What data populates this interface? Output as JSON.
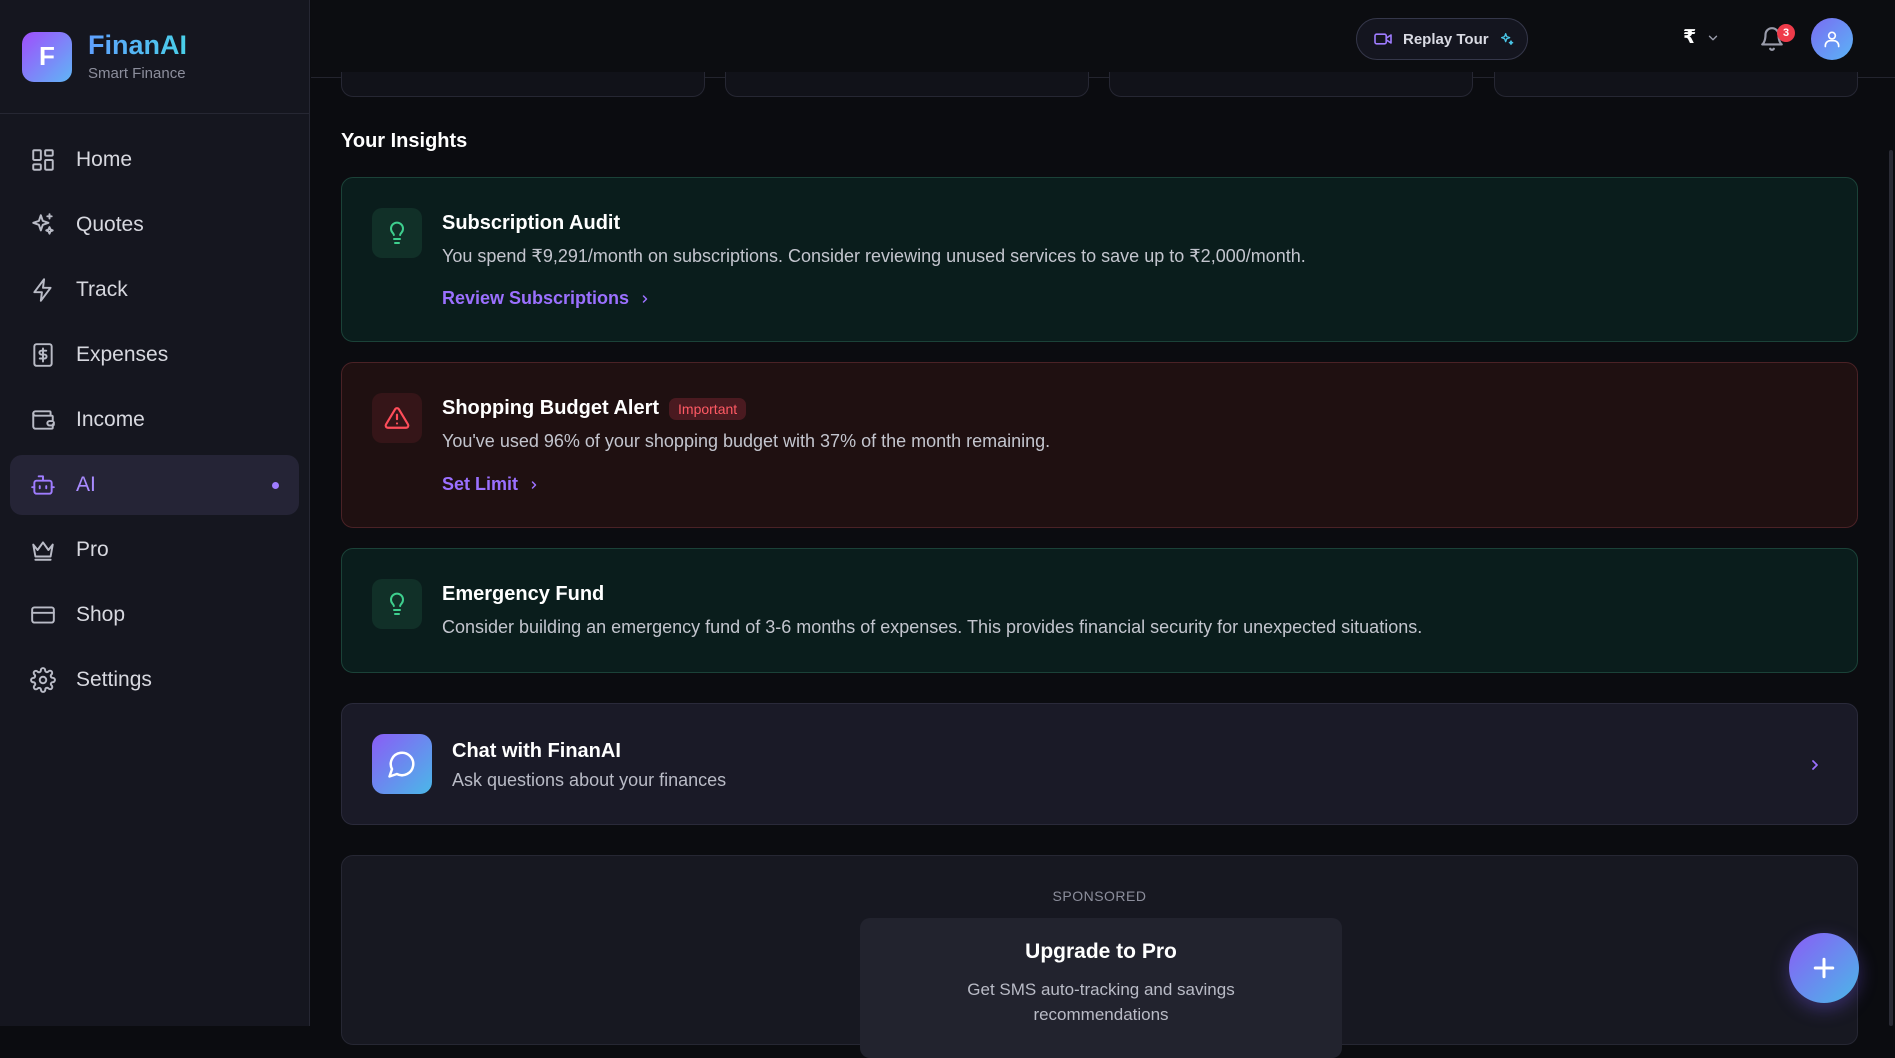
{
  "brand": {
    "logo_letter": "F",
    "name": "FinanAI",
    "subtitle": "Smart Finance"
  },
  "sidebar": {
    "items": [
      {
        "label": "Home",
        "icon": "grid-icon",
        "active": false
      },
      {
        "label": "Quotes",
        "icon": "sparkles-icon",
        "active": false
      },
      {
        "label": "Track",
        "icon": "lightning-icon",
        "active": false
      },
      {
        "label": "Expenses",
        "icon": "dollar-receipt-icon",
        "active": false
      },
      {
        "label": "Income",
        "icon": "wallet-icon",
        "active": false
      },
      {
        "label": "AI",
        "icon": "robot-icon",
        "active": true
      },
      {
        "label": "Pro",
        "icon": "crown-icon",
        "active": false
      },
      {
        "label": "Shop",
        "icon": "credit-card-icon",
        "active": false
      },
      {
        "label": "Settings",
        "icon": "gear-icon",
        "active": false
      }
    ]
  },
  "header": {
    "replay_tour_label": "Replay Tour",
    "currency_symbol": "₹",
    "notification_count": "3"
  },
  "main": {
    "section_title": "Your Insights",
    "insights": [
      {
        "type": "tip",
        "title": "Subscription Audit",
        "description": "You spend ₹9,291/month on subscriptions. Consider reviewing unused services to save up to ₹2,000/month.",
        "action_label": "Review Subscriptions"
      },
      {
        "type": "alert",
        "title": "Shopping Budget Alert",
        "tag": "Important",
        "description": "You've used 96% of your shopping budget with 37% of the month remaining.",
        "action_label": "Set Limit"
      },
      {
        "type": "tip",
        "title": "Emergency Fund",
        "description": "Consider building an emergency fund of 3-6 months of expenses. This provides financial security for unexpected situations."
      }
    ],
    "chat": {
      "title": "Chat with FinanAI",
      "subtitle": "Ask questions about your finances"
    },
    "sponsored": {
      "label": "SPONSORED",
      "promo_title": "Upgrade to Pro",
      "promo_description": "Get SMS auto-tracking and savings recommendations"
    }
  },
  "colors": {
    "accent": "#9b70ff",
    "tip_bg": "#0a1d1c",
    "alert_bg": "#1f1011",
    "alert_text": "#ff5a64",
    "success": "#3ecf8e"
  }
}
